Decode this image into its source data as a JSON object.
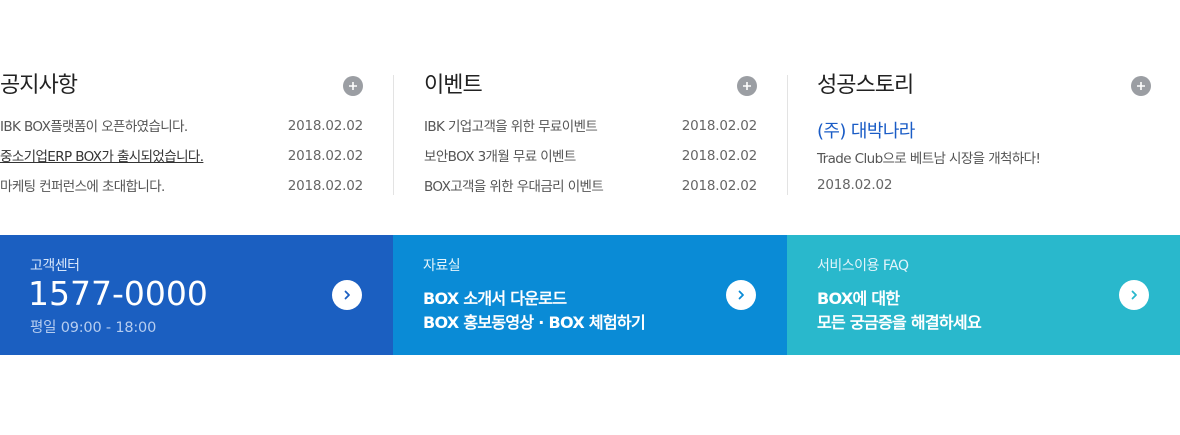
{
  "colors": {
    "cs_banner": "#1b5fc1",
    "docs_banner": "#0a8bd6",
    "faq_banner": "#29b8cc",
    "more_button": "#9b9ea3",
    "story_company": "#1a5cc6"
  },
  "notice": {
    "title": "공지사항",
    "more_icon": "plus-icon",
    "items": [
      {
        "subject": "IBK BOX플랫폼이 오픈하였습니다.",
        "date": "2018.02.02"
      },
      {
        "subject": "중소기업ERP BOX가 출시되었습니다.",
        "date": "2018.02.02"
      },
      {
        "subject": "마케팅 컨퍼런스에 초대합니다.",
        "date": "2018.02.02"
      }
    ]
  },
  "event": {
    "title": "이벤트",
    "more_icon": "plus-icon",
    "items": [
      {
        "subject": "IBK 기업고객을 위한 무료이벤트",
        "date": "2018.02.02"
      },
      {
        "subject": "보안BOX 3개월 무료 이벤트",
        "date": "2018.02.02"
      },
      {
        "subject": "BOX고객을 위한 우대금리 이벤트",
        "date": "2018.02.02"
      }
    ]
  },
  "story": {
    "title": "성공스토리",
    "more_icon": "plus-icon",
    "company": "(주) 대박나라",
    "description": "Trade Club으로 베트남 시장을 개척하다!",
    "date": "2018.02.02"
  },
  "banners": {
    "customer_center": {
      "label": "고객센터",
      "phone": "1577-0000",
      "hours": "평일 09:00 - 18:00",
      "icon": "chevron-right-icon"
    },
    "docs": {
      "label": "자료실",
      "line1": "BOX 소개서 다운로드",
      "line2": "BOX 홍보동영상 · BOX 체험하기",
      "icon": "chevron-right-icon"
    },
    "faq": {
      "label": "서비스이용 FAQ",
      "line1": "BOX에 대한",
      "line2": "모든 궁금증을 해결하세요",
      "icon": "chevron-right-icon"
    }
  }
}
